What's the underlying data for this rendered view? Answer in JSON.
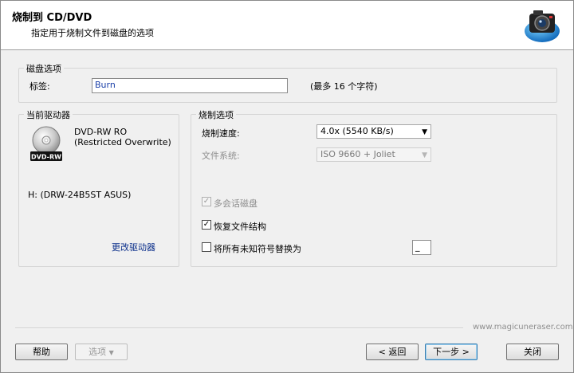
{
  "header": {
    "title": "烧制到 CD/DVD",
    "subtitle": "指定用于烧制文件到磁盘的选项",
    "logo_icon": "camera-disc-icon"
  },
  "disc_options": {
    "legend": "磁盘选项",
    "label_caption": "标签:",
    "label_value": "Burn",
    "hint": "(最多 16 个字符)"
  },
  "current_drive": {
    "legend": "当前驱动器",
    "media_badge": "DVD-RW",
    "media_desc": "DVD-RW RO (Restricted Overwrite)",
    "drive_name": "H: (DRW-24B5ST ASUS)",
    "change_drive": "更改驱动器"
  },
  "burn_options": {
    "legend": "烧制选项",
    "speed_label": "烧制速度:",
    "speed_value": "4.0x (5540 KB/s)",
    "fs_label": "文件系统:",
    "fs_value": "ISO 9660 + Joliet",
    "multisession_label": "多会话磁盘",
    "multisession_checked": true,
    "restore_structure_label": "恢复文件结构",
    "restore_structure_checked": true,
    "replace_unknown_label": "将所有未知符号替换为",
    "replace_unknown_checked": false,
    "replace_char": "_"
  },
  "footer": {
    "website": "www.magicuneraser.com",
    "help": "帮助",
    "options": "选项",
    "back": "< 返回",
    "next": "下一步 >",
    "close": "关闭"
  }
}
